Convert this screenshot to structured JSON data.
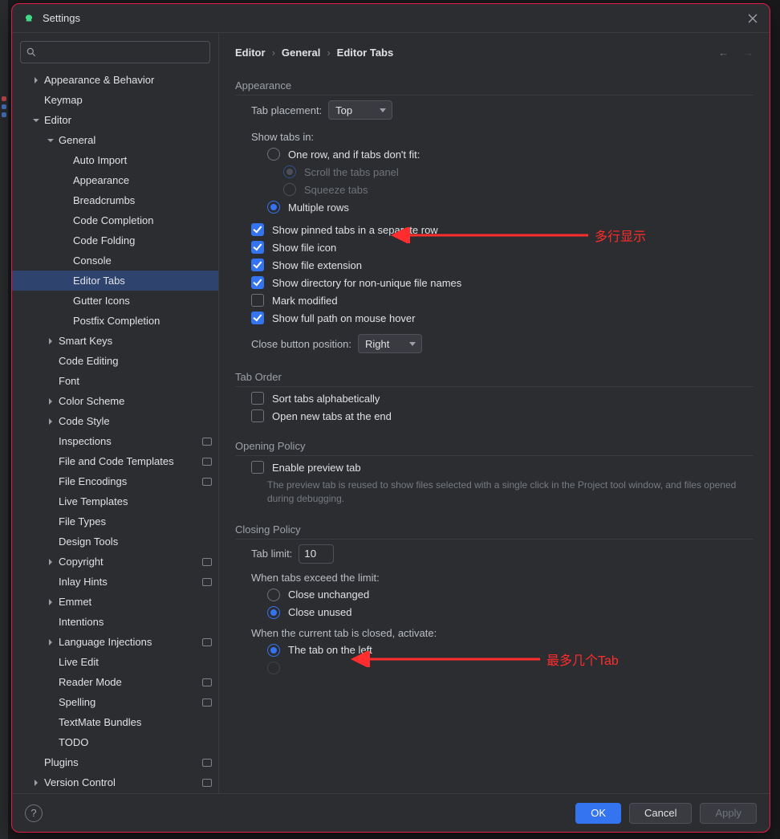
{
  "window": {
    "title": "Settings"
  },
  "search": {
    "placeholder": ""
  },
  "tree": [
    {
      "label": "Appearance & Behavior",
      "depth": 0,
      "caret": "right",
      "sel": false
    },
    {
      "label": "Keymap",
      "depth": 0,
      "caret": "none",
      "sel": false
    },
    {
      "label": "Editor",
      "depth": 0,
      "caret": "down",
      "sel": false
    },
    {
      "label": "General",
      "depth": 1,
      "caret": "down",
      "sel": false
    },
    {
      "label": "Auto Import",
      "depth": 2,
      "caret": "none",
      "sel": false
    },
    {
      "label": "Appearance",
      "depth": 2,
      "caret": "none",
      "sel": false
    },
    {
      "label": "Breadcrumbs",
      "depth": 2,
      "caret": "none",
      "sel": false
    },
    {
      "label": "Code Completion",
      "depth": 2,
      "caret": "none",
      "sel": false
    },
    {
      "label": "Code Folding",
      "depth": 2,
      "caret": "none",
      "sel": false
    },
    {
      "label": "Console",
      "depth": 2,
      "caret": "none",
      "sel": false
    },
    {
      "label": "Editor Tabs",
      "depth": 2,
      "caret": "none",
      "sel": true
    },
    {
      "label": "Gutter Icons",
      "depth": 2,
      "caret": "none",
      "sel": false
    },
    {
      "label": "Postfix Completion",
      "depth": 2,
      "caret": "none",
      "sel": false
    },
    {
      "label": "Smart Keys",
      "depth": 1,
      "caret": "right",
      "sel": false,
      "pad": true
    },
    {
      "label": "Code Editing",
      "depth": 1,
      "caret": "none",
      "sel": false
    },
    {
      "label": "Font",
      "depth": 1,
      "caret": "none",
      "sel": false
    },
    {
      "label": "Color Scheme",
      "depth": 1,
      "caret": "right",
      "sel": false
    },
    {
      "label": "Code Style",
      "depth": 1,
      "caret": "right",
      "sel": false
    },
    {
      "label": "Inspections",
      "depth": 1,
      "caret": "none",
      "sel": false,
      "badge": true
    },
    {
      "label": "File and Code Templates",
      "depth": 1,
      "caret": "none",
      "sel": false,
      "badge": true
    },
    {
      "label": "File Encodings",
      "depth": 1,
      "caret": "none",
      "sel": false,
      "badge": true
    },
    {
      "label": "Live Templates",
      "depth": 1,
      "caret": "none",
      "sel": false
    },
    {
      "label": "File Types",
      "depth": 1,
      "caret": "none",
      "sel": false
    },
    {
      "label": "Design Tools",
      "depth": 1,
      "caret": "none",
      "sel": false
    },
    {
      "label": "Copyright",
      "depth": 1,
      "caret": "right",
      "sel": false,
      "badge": true
    },
    {
      "label": "Inlay Hints",
      "depth": 1,
      "caret": "none",
      "sel": false,
      "badge": true
    },
    {
      "label": "Emmet",
      "depth": 1,
      "caret": "right",
      "sel": false
    },
    {
      "label": "Intentions",
      "depth": 1,
      "caret": "none",
      "sel": false
    },
    {
      "label": "Language Injections",
      "depth": 1,
      "caret": "right",
      "sel": false,
      "badge": true
    },
    {
      "label": "Live Edit",
      "depth": 1,
      "caret": "none",
      "sel": false
    },
    {
      "label": "Reader Mode",
      "depth": 1,
      "caret": "none",
      "sel": false,
      "badge": true
    },
    {
      "label": "Spelling",
      "depth": 1,
      "caret": "none",
      "sel": false,
      "badge": true
    },
    {
      "label": "TextMate Bundles",
      "depth": 1,
      "caret": "none",
      "sel": false
    },
    {
      "label": "TODO",
      "depth": 1,
      "caret": "none",
      "sel": false
    },
    {
      "label": "Plugins",
      "depth": 0,
      "caret": "none",
      "sel": false,
      "badge": true
    },
    {
      "label": "Version Control",
      "depth": 0,
      "caret": "right",
      "sel": false,
      "badge": true
    }
  ],
  "breadcrumbs": [
    "Editor",
    "General",
    "Editor Tabs"
  ],
  "sections": {
    "appearance": {
      "title": "Appearance",
      "tab_placement_label": "Tab placement:",
      "tab_placement_value": "Top",
      "show_tabs_in_label": "Show tabs in:",
      "one_row_label": "One row, and if tabs don't fit:",
      "scroll_label": "Scroll the tabs panel",
      "squeeze_label": "Squeeze tabs",
      "multiple_rows_label": "Multiple rows",
      "show_pinned": "Show pinned tabs in a separate row",
      "show_file_icon": "Show file icon",
      "show_file_ext": "Show file extension",
      "show_dir_non_unique": "Show directory for non-unique file names",
      "mark_modified": "Mark modified",
      "show_full_path_hover": "Show full path on mouse hover",
      "close_btn_pos_label": "Close button position:",
      "close_btn_pos_value": "Right"
    },
    "tab_order": {
      "title": "Tab Order",
      "sort_alpha": "Sort tabs alphabetically",
      "open_end": "Open new tabs at the end"
    },
    "opening": {
      "title": "Opening Policy",
      "enable_preview": "Enable preview tab",
      "preview_hint": "The preview tab is reused to show files selected with a single click in the Project tool window, and files opened during debugging."
    },
    "closing": {
      "title": "Closing Policy",
      "tab_limit_label": "Tab limit:",
      "tab_limit_value": "10",
      "exceed_label": "When tabs exceed the limit:",
      "close_unchanged": "Close unchanged",
      "close_unused": "Close unused",
      "when_closed_label": "When the current tab is closed, activate:",
      "tab_left": "The tab on the left"
    }
  },
  "annotations": {
    "multiline": "多行显示",
    "maxtabs": "最多几个Tab"
  },
  "footer": {
    "ok": "OK",
    "cancel": "Cancel",
    "apply": "Apply"
  }
}
